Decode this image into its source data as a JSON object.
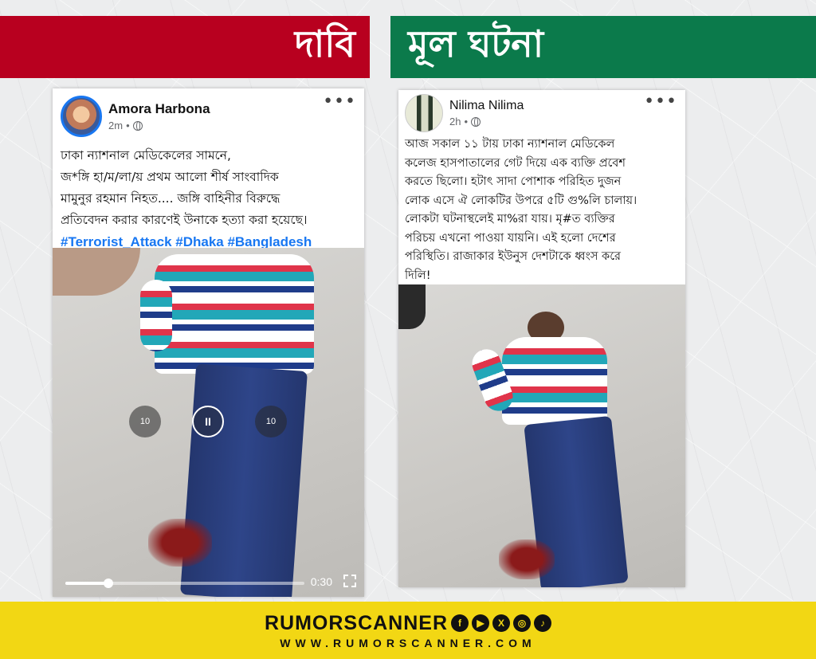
{
  "colors": {
    "claim_banner": "#b8001f",
    "fact_banner": "#0b7a4b",
    "footer_bg": "#f2d714",
    "hashtag": "#1877f2"
  },
  "banners": {
    "claim": "দাবি",
    "fact": "মূল ঘটনা"
  },
  "left_post": {
    "author": "Amora Harbona",
    "time": "2m",
    "dot": "•",
    "more": "•••",
    "text_lines": [
      "ঢাকা ন্যাশনাল মেডিকেলের সামনে,",
      "জ*ঙ্গি হা/ম/লা/য় প্রথম আলো শীর্ষ সাংবাদিক",
      "মামুনুর রহমান নিহত.... জঙ্গি বাহিনীর বিরুদ্ধে",
      "প্রতিবেদন করার কারণেই উনাকে হত্যা করা হয়েছে।"
    ],
    "hashtags": "#Terrorist_Attack #Dhaka #Bangladesh",
    "video": {
      "rewind_label": "10",
      "forward_label": "10",
      "play_state": "II",
      "duration": "0:30",
      "progress": 0.18
    }
  },
  "right_post": {
    "author": "Nilima Nilima",
    "time": "2h",
    "dot": "•",
    "more": "•••",
    "text_lines": [
      "আজ সকাল ১১ টায়  ঢাকা ন্যাশনাল মেডিকেল",
      "কলেজ হাসপাতালের গেট দিয়ে এক ব্যক্তি প্রবেশ",
      "করতে ছিলো। হটাৎ সাদা পোশাক পরিহিত দুজন",
      "লোক এসে ঐ লোকটির উপরে ৫টি গু%লি চালায়।",
      "লোকটা ঘটনাস্থলেই মা%রা যায়। মৃ#ত ব্যক্তির",
      "পরিচয় এখনো পাওয়া যায়নি। এই হলো দেশের",
      "পরিস্থিতি। রাজাকার ইউনুস দেশটাকে ধ্বংস করে",
      "দিলি!"
    ]
  },
  "footer": {
    "brand": "RUMORSCANNER",
    "url": "WWW.RUMORSCANNER.COM",
    "social_icons": [
      "facebook-icon",
      "youtube-icon",
      "x-icon",
      "instagram-icon",
      "tiktok-icon"
    ]
  }
}
